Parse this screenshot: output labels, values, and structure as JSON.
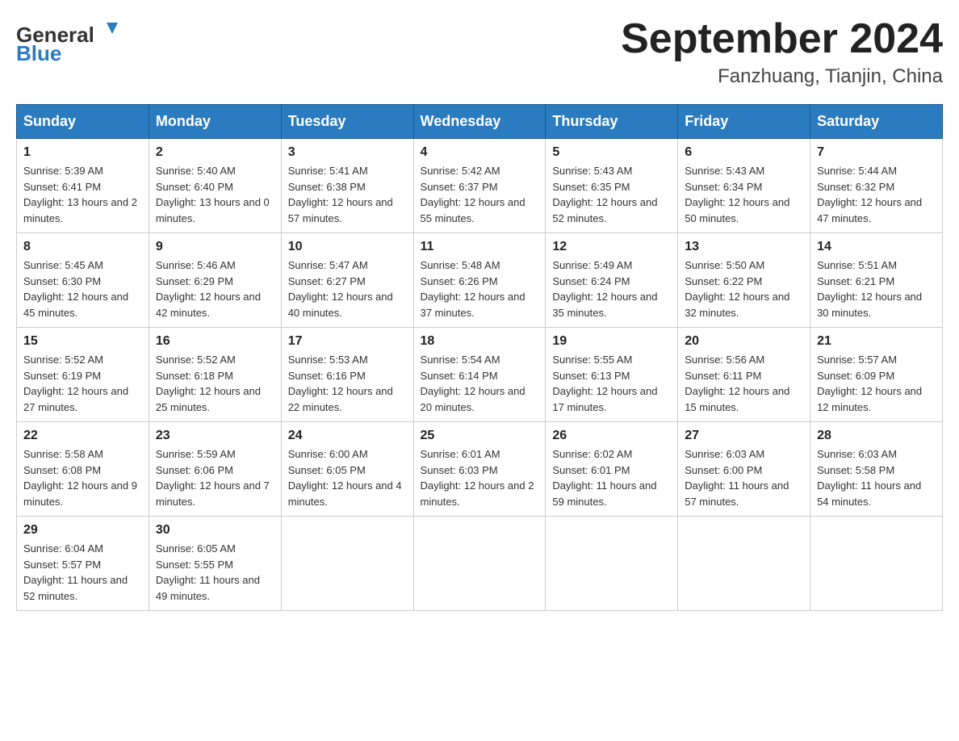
{
  "header": {
    "logo_general": "General",
    "logo_blue": "Blue",
    "title": "September 2024",
    "subtitle": "Fanzhuang, Tianjin, China"
  },
  "weekdays": [
    "Sunday",
    "Monday",
    "Tuesday",
    "Wednesday",
    "Thursday",
    "Friday",
    "Saturday"
  ],
  "weeks": [
    [
      {
        "day": "1",
        "sunrise": "5:39 AM",
        "sunset": "6:41 PM",
        "daylight": "13 hours and 2 minutes."
      },
      {
        "day": "2",
        "sunrise": "5:40 AM",
        "sunset": "6:40 PM",
        "daylight": "13 hours and 0 minutes."
      },
      {
        "day": "3",
        "sunrise": "5:41 AM",
        "sunset": "6:38 PM",
        "daylight": "12 hours and 57 minutes."
      },
      {
        "day": "4",
        "sunrise": "5:42 AM",
        "sunset": "6:37 PM",
        "daylight": "12 hours and 55 minutes."
      },
      {
        "day": "5",
        "sunrise": "5:43 AM",
        "sunset": "6:35 PM",
        "daylight": "12 hours and 52 minutes."
      },
      {
        "day": "6",
        "sunrise": "5:43 AM",
        "sunset": "6:34 PM",
        "daylight": "12 hours and 50 minutes."
      },
      {
        "day": "7",
        "sunrise": "5:44 AM",
        "sunset": "6:32 PM",
        "daylight": "12 hours and 47 minutes."
      }
    ],
    [
      {
        "day": "8",
        "sunrise": "5:45 AM",
        "sunset": "6:30 PM",
        "daylight": "12 hours and 45 minutes."
      },
      {
        "day": "9",
        "sunrise": "5:46 AM",
        "sunset": "6:29 PM",
        "daylight": "12 hours and 42 minutes."
      },
      {
        "day": "10",
        "sunrise": "5:47 AM",
        "sunset": "6:27 PM",
        "daylight": "12 hours and 40 minutes."
      },
      {
        "day": "11",
        "sunrise": "5:48 AM",
        "sunset": "6:26 PM",
        "daylight": "12 hours and 37 minutes."
      },
      {
        "day": "12",
        "sunrise": "5:49 AM",
        "sunset": "6:24 PM",
        "daylight": "12 hours and 35 minutes."
      },
      {
        "day": "13",
        "sunrise": "5:50 AM",
        "sunset": "6:22 PM",
        "daylight": "12 hours and 32 minutes."
      },
      {
        "day": "14",
        "sunrise": "5:51 AM",
        "sunset": "6:21 PM",
        "daylight": "12 hours and 30 minutes."
      }
    ],
    [
      {
        "day": "15",
        "sunrise": "5:52 AM",
        "sunset": "6:19 PM",
        "daylight": "12 hours and 27 minutes."
      },
      {
        "day": "16",
        "sunrise": "5:52 AM",
        "sunset": "6:18 PM",
        "daylight": "12 hours and 25 minutes."
      },
      {
        "day": "17",
        "sunrise": "5:53 AM",
        "sunset": "6:16 PM",
        "daylight": "12 hours and 22 minutes."
      },
      {
        "day": "18",
        "sunrise": "5:54 AM",
        "sunset": "6:14 PM",
        "daylight": "12 hours and 20 minutes."
      },
      {
        "day": "19",
        "sunrise": "5:55 AM",
        "sunset": "6:13 PM",
        "daylight": "12 hours and 17 minutes."
      },
      {
        "day": "20",
        "sunrise": "5:56 AM",
        "sunset": "6:11 PM",
        "daylight": "12 hours and 15 minutes."
      },
      {
        "day": "21",
        "sunrise": "5:57 AM",
        "sunset": "6:09 PM",
        "daylight": "12 hours and 12 minutes."
      }
    ],
    [
      {
        "day": "22",
        "sunrise": "5:58 AM",
        "sunset": "6:08 PM",
        "daylight": "12 hours and 9 minutes."
      },
      {
        "day": "23",
        "sunrise": "5:59 AM",
        "sunset": "6:06 PM",
        "daylight": "12 hours and 7 minutes."
      },
      {
        "day": "24",
        "sunrise": "6:00 AM",
        "sunset": "6:05 PM",
        "daylight": "12 hours and 4 minutes."
      },
      {
        "day": "25",
        "sunrise": "6:01 AM",
        "sunset": "6:03 PM",
        "daylight": "12 hours and 2 minutes."
      },
      {
        "day": "26",
        "sunrise": "6:02 AM",
        "sunset": "6:01 PM",
        "daylight": "11 hours and 59 minutes."
      },
      {
        "day": "27",
        "sunrise": "6:03 AM",
        "sunset": "6:00 PM",
        "daylight": "11 hours and 57 minutes."
      },
      {
        "day": "28",
        "sunrise": "6:03 AM",
        "sunset": "5:58 PM",
        "daylight": "11 hours and 54 minutes."
      }
    ],
    [
      {
        "day": "29",
        "sunrise": "6:04 AM",
        "sunset": "5:57 PM",
        "daylight": "11 hours and 52 minutes."
      },
      {
        "day": "30",
        "sunrise": "6:05 AM",
        "sunset": "5:55 PM",
        "daylight": "11 hours and 49 minutes."
      },
      null,
      null,
      null,
      null,
      null
    ]
  ]
}
